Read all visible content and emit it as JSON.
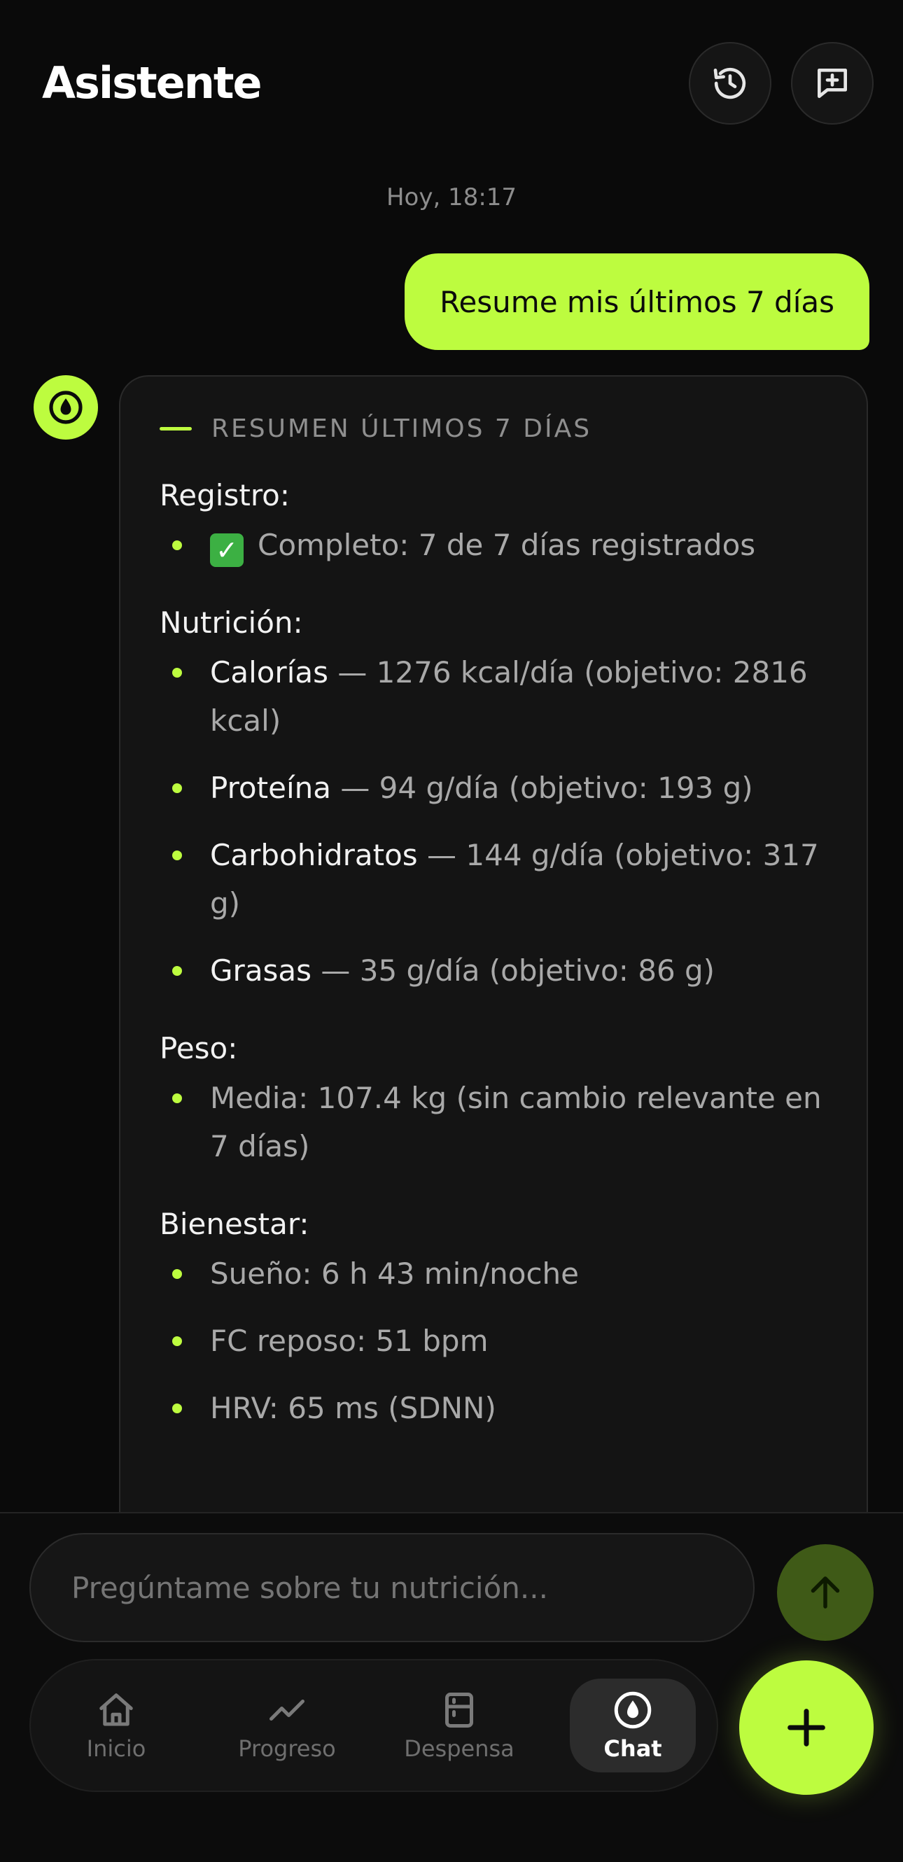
{
  "header": {
    "title": "Asistente",
    "icons": {
      "history": "history-icon",
      "new_chat": "new-chat-icon"
    }
  },
  "timestamp": "Hoy, 18:17",
  "user_message": "Resume mis últimos 7 días",
  "summary": {
    "title": "RESUMEN ÚLTIMOS 7 DÍAS",
    "registro": {
      "heading": "Registro:",
      "check_glyph": "✓",
      "item": "Completo: 7 de 7 días registrados"
    },
    "nutricion": {
      "heading": "Nutrición:",
      "items": [
        {
          "label": "Calorías",
          "value": " — 1276 kcal/día (objetivo: 2816 kcal)"
        },
        {
          "label": "Proteína",
          "value": " — 94 g/día (objetivo: 193 g)"
        },
        {
          "label": "Carbohidratos",
          "value": " — 144 g/día (objetivo: 317 g)"
        },
        {
          "label": "Grasas",
          "value": " — 35 g/día (objetivo: 86 g)"
        }
      ]
    },
    "peso": {
      "heading": "Peso:",
      "item": "Media: 107.4 kg (sin cambio relevante en 7 días)"
    },
    "bienestar": {
      "heading": "Bienestar:",
      "items": [
        "Sueño: 6 h 43 min/noche",
        "FC reposo: 51 bpm",
        "HRV: 65 ms (SDNN)"
      ]
    }
  },
  "input": {
    "placeholder": "Pregúntame sobre tu nutrición..."
  },
  "nav": {
    "items": [
      {
        "label": "Inicio",
        "icon": "home-icon"
      },
      {
        "label": "Progreso",
        "icon": "trend-icon"
      },
      {
        "label": "Despensa",
        "icon": "pantry-icon"
      },
      {
        "label": "Chat",
        "icon": "drop-logo-icon"
      }
    ],
    "active": "Chat"
  },
  "colors": {
    "accent": "#bdfc3f",
    "background": "#0a0a0a",
    "card": "#141414",
    "send_button": "#3f5a17"
  }
}
